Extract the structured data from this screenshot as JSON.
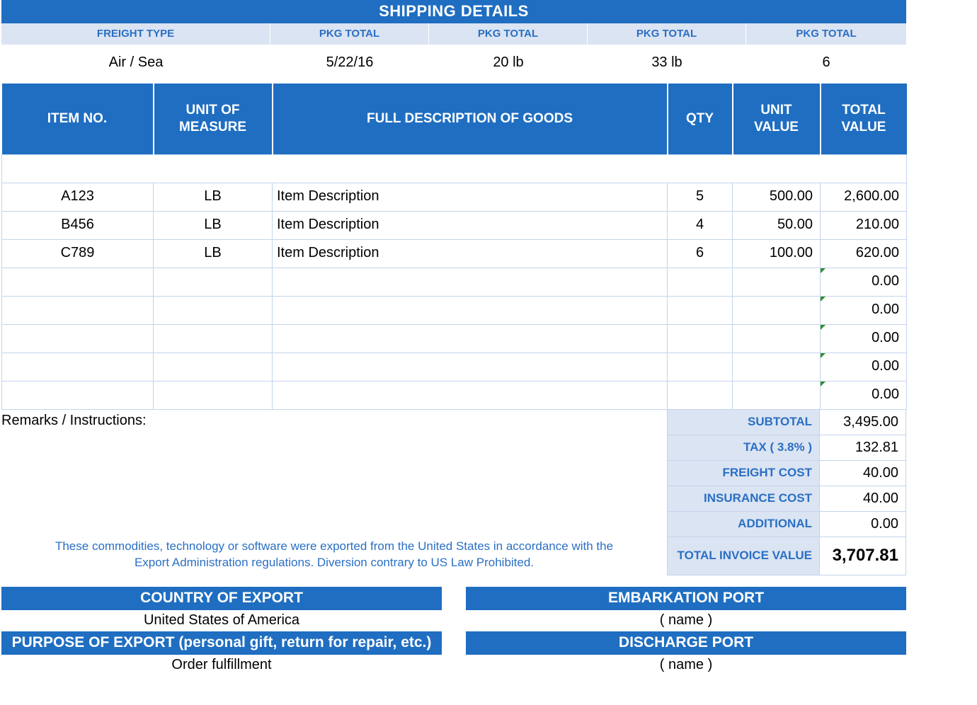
{
  "shipping": {
    "title": "SHIPPING DETAILS",
    "headers": [
      "FREIGHT TYPE",
      "PKG TOTAL",
      "PKG TOTAL",
      "PKG TOTAL",
      "PKG TOTAL"
    ],
    "values": [
      "Air / Sea",
      "5/22/16",
      "20 lb",
      "33 lb",
      "6"
    ]
  },
  "items": {
    "columns": [
      "ITEM NO.",
      "UNIT OF MEASURE",
      "FULL DESCRIPTION OF GOODS",
      "QTY",
      "UNIT VALUE",
      "TOTAL VALUE"
    ],
    "rows": [
      {
        "item_no": "A123",
        "uom": "LB",
        "desc": "Item Description",
        "qty": "5",
        "unit_value": "500.00",
        "total_value": "2,600.00"
      },
      {
        "item_no": "B456",
        "uom": "LB",
        "desc": "Item Description",
        "qty": "4",
        "unit_value": "50.00",
        "total_value": "210.00"
      },
      {
        "item_no": "C789",
        "uom": "LB",
        "desc": "Item Description",
        "qty": "6",
        "unit_value": "100.00",
        "total_value": "620.00"
      },
      {
        "item_no": "",
        "uom": "",
        "desc": "",
        "qty": "",
        "unit_value": "",
        "total_value": "0.00"
      },
      {
        "item_no": "",
        "uom": "",
        "desc": "",
        "qty": "",
        "unit_value": "",
        "total_value": "0.00"
      },
      {
        "item_no": "",
        "uom": "",
        "desc": "",
        "qty": "",
        "unit_value": "",
        "total_value": "0.00"
      },
      {
        "item_no": "",
        "uom": "",
        "desc": "",
        "qty": "",
        "unit_value": "",
        "total_value": "0.00"
      },
      {
        "item_no": "",
        "uom": "",
        "desc": "",
        "qty": "",
        "unit_value": "",
        "total_value": "0.00"
      }
    ]
  },
  "remarks_label": "Remarks / Instructions:",
  "disclaimer": "These commodities, technology or software were exported from the United States in accordance with the Export Administration regulations.  Diversion contrary to US Law Prohibited.",
  "totals": {
    "subtotal_label": "SUBTOTAL",
    "subtotal_value": "3,495.00",
    "tax_label": "TAX ( 3.8% )",
    "tax_value": "132.81",
    "freight_label": "FREIGHT COST",
    "freight_value": "40.00",
    "insurance_label": "INSURANCE COST",
    "insurance_value": "40.00",
    "additional_label": "ADDITIONAL",
    "additional_value": "0.00",
    "grand_label": "TOTAL INVOICE VALUE",
    "grand_value": "3,707.81"
  },
  "exports": {
    "country_label": "COUNTRY OF EXPORT",
    "country_value": "United States of America",
    "purpose_label": "PURPOSE OF EXPORT (personal gift, return for repair, etc.)",
    "purpose_value": "Order fulfillment",
    "embark_label": "EMBARKATION PORT",
    "embark_value": "( name )",
    "discharge_label": "DISCHARGE PORT",
    "discharge_value": "( name )"
  }
}
